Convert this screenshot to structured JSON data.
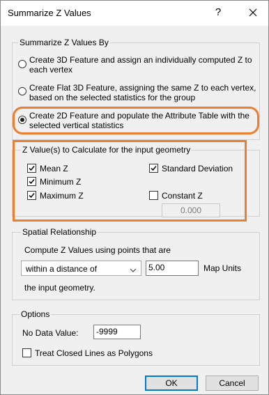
{
  "dialog": {
    "title": "Summarize Z Values",
    "help_glyph": "?",
    "close_icon": "close-icon"
  },
  "summarize_by": {
    "legend": "Summarize Z Values By",
    "options": [
      {
        "line1": "Create 3D Feature and assign an individually computed Z to",
        "line2": "each vertex",
        "selected": false
      },
      {
        "line1": "Create Flat 3D Feature, assigning the same Z to each vertex,",
        "line2": "based on the selected statistics for the group",
        "selected": false
      },
      {
        "line1": "Create 2D Feature and populate the Attribute Table with the",
        "line2": "selected vertical statistics",
        "selected": true
      }
    ]
  },
  "z_values": {
    "legend": "Z Value(s) to Calculate for the input geometry",
    "mean_z": {
      "label": "Mean Z",
      "checked": true
    },
    "minimum_z": {
      "label": "Minimum Z",
      "checked": true
    },
    "maximum_z": {
      "label": "Maximum Z",
      "checked": true
    },
    "standard_deviation": {
      "label": "Standard Deviation",
      "checked": true
    },
    "constant_z": {
      "label": "Constant Z",
      "checked": false,
      "value": "0.000"
    }
  },
  "spatial": {
    "legend": "Spatial Relationship",
    "compute_label": "Compute Z Values using points that are",
    "relationship": "within a distance of",
    "distance": "5.00",
    "units": "Map Units",
    "suffix": "the input geometry."
  },
  "options": {
    "legend": "Options",
    "no_data_label": "No Data Value:",
    "no_data_value": "-9999",
    "treat_closed": {
      "label": "Treat Closed Lines as Polygons",
      "checked": false
    }
  },
  "buttons": {
    "ok": "OK",
    "cancel": "Cancel"
  },
  "colors": {
    "highlight": "#ed7d31",
    "default_button_border": "#0078d7"
  }
}
